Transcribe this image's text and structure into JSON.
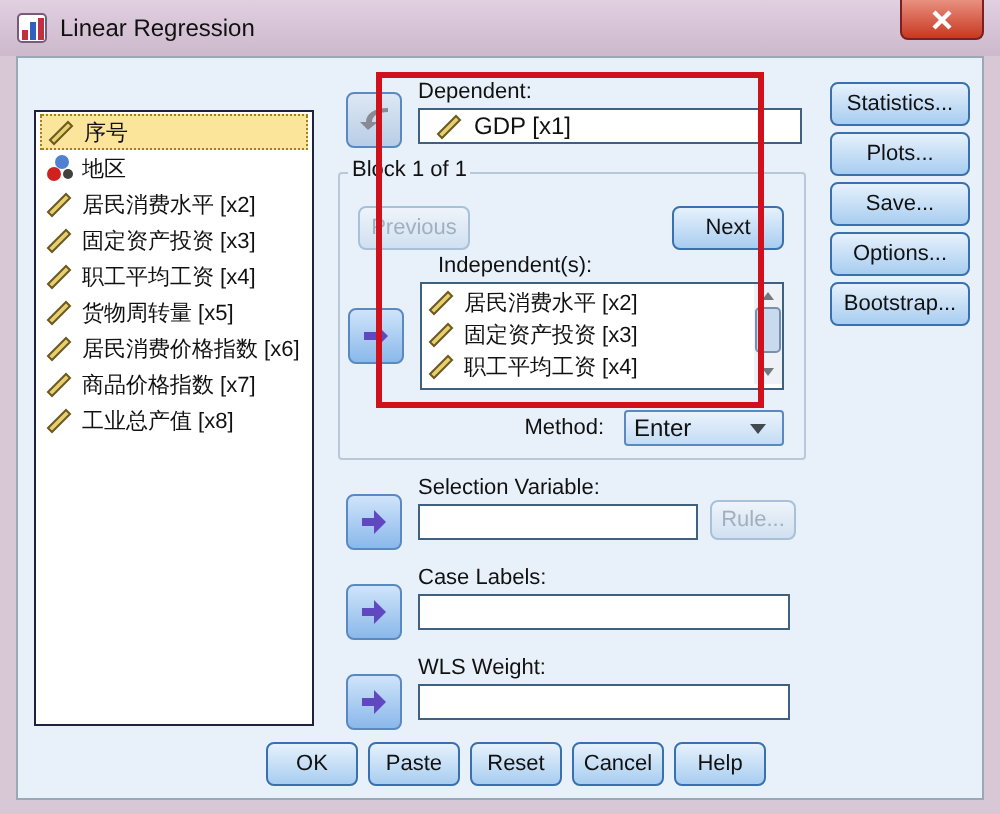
{
  "window": {
    "title": "Linear Regression"
  },
  "variables": [
    {
      "label": "序号",
      "kind": "scale",
      "selected": true
    },
    {
      "label": "地区",
      "kind": "nominal",
      "selected": false
    },
    {
      "label": "居民消费水平 [x2]",
      "kind": "scale",
      "selected": false
    },
    {
      "label": "固定资产投资 [x3]",
      "kind": "scale",
      "selected": false
    },
    {
      "label": "职工平均工资 [x4]",
      "kind": "scale",
      "selected": false
    },
    {
      "label": "货物周转量 [x5]",
      "kind": "scale",
      "selected": false
    },
    {
      "label": "居民消费价格指数 [x6]",
      "kind": "scale",
      "selected": false
    },
    {
      "label": "商品价格指数 [x7]",
      "kind": "scale",
      "selected": false
    },
    {
      "label": "工业总产值 [x8]",
      "kind": "scale",
      "selected": false
    }
  ],
  "dependent": {
    "label": "Dependent:",
    "reversed": true,
    "value": {
      "label": "GDP [x1]",
      "kind": "scale"
    }
  },
  "block": {
    "title": "Block 1 of 1",
    "buttons": [
      {
        "label": "Previous",
        "disabled": true
      },
      {
        "label": "Next",
        "disabled": false
      }
    ]
  },
  "independents": {
    "label": "Independent(s):",
    "reversed": false,
    "items": [
      {
        "label": "居民消费水平 [x2]",
        "kind": "scale"
      },
      {
        "label": "固定资产投资 [x3]",
        "kind": "scale"
      },
      {
        "label": "职工平均工资 [x4]",
        "kind": "scale"
      }
    ]
  },
  "method": {
    "label": "Method:",
    "value": "Enter"
  },
  "targets": [
    {
      "label": "Selection Variable:",
      "reversed": false,
      "button": {
        "label": "Rule...",
        "disabled": true
      }
    },
    {
      "label": "Case Labels:",
      "reversed": false
    },
    {
      "label": "WLS Weight:",
      "reversed": false
    }
  ],
  "side_buttons": [
    "Statistics...",
    "Plots...",
    "Save...",
    "Options...",
    "Bootstrap..."
  ],
  "footer_buttons": [
    "OK",
    "Paste",
    "Reset",
    "Cancel",
    "Help"
  ]
}
